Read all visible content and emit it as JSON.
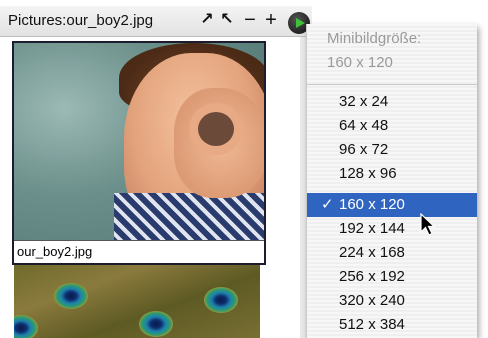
{
  "window": {
    "title": "Pictures:our_boy2.jpg",
    "buttons": [
      "↗",
      "↖",
      "−",
      "+"
    ]
  },
  "thumbnails": [
    {
      "caption": "our_boy2.jpg"
    },
    {
      "caption": ""
    }
  ],
  "menu": {
    "header_label": "Minibildgröße:",
    "header_value": "160 x 120",
    "items": [
      {
        "label": "32 x 24",
        "selected": false
      },
      {
        "label": "64 x 48",
        "selected": false
      },
      {
        "label": "96 x 72",
        "selected": false
      },
      {
        "label": "128 x 96",
        "selected": false
      },
      {
        "label": "160 x 120",
        "selected": true
      },
      {
        "label": "192 x 144",
        "selected": false
      },
      {
        "label": "224 x 168",
        "selected": false
      },
      {
        "label": "256 x 192",
        "selected": false
      },
      {
        "label": "320 x 240",
        "selected": false
      },
      {
        "label": "512 x 384",
        "selected": false
      }
    ],
    "check_mark": "✓",
    "selected_color": "#2f64c0"
  }
}
